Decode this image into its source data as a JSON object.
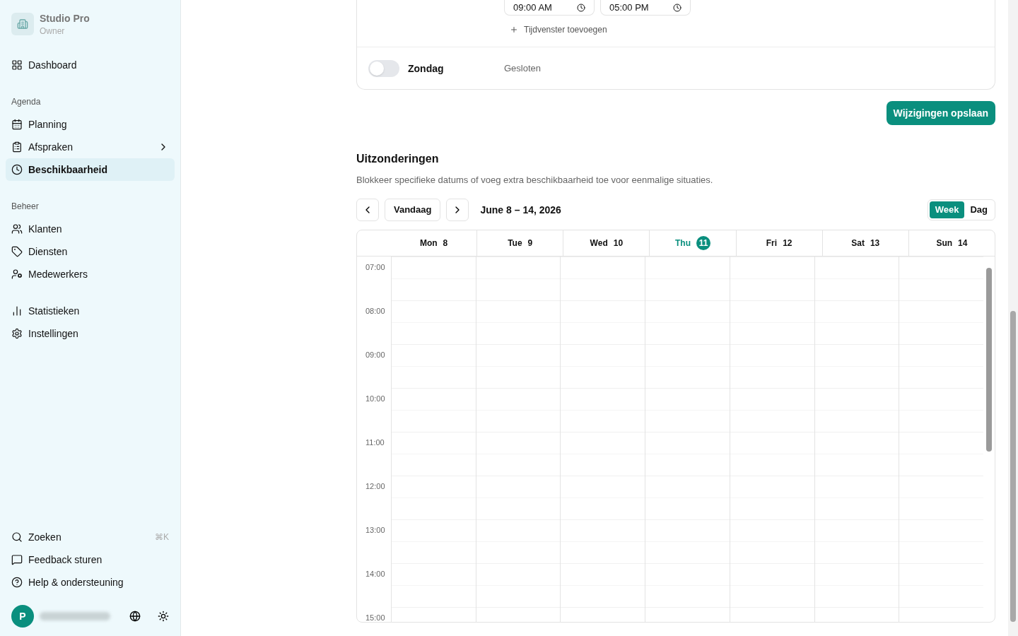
{
  "sidebar": {
    "brand": {
      "name": "Studio Pro",
      "role": "Owner"
    },
    "sections": [
      {
        "items": [
          {
            "label": "Dashboard",
            "selected": false
          }
        ]
      },
      {
        "heading": "Agenda",
        "items": [
          {
            "label": "Planning",
            "selected": false
          },
          {
            "label": "Afspraken",
            "selected": false,
            "has_submenu": true
          },
          {
            "label": "Beschikbaarheid",
            "selected": true
          }
        ]
      },
      {
        "heading": "Beheer",
        "items": [
          {
            "label": "Klanten",
            "selected": false
          },
          {
            "label": "Diensten",
            "selected": false
          },
          {
            "label": "Medewerkers",
            "selected": false
          }
        ]
      },
      {
        "items": [
          {
            "label": "Statistieken",
            "selected": false
          },
          {
            "label": "Instellingen",
            "selected": false
          }
        ]
      }
    ],
    "footer_items": [
      {
        "label": "Zoeken",
        "shortcut": "⌘K"
      },
      {
        "label": "Feedback sturen"
      },
      {
        "label": "Help & ondersteuning"
      }
    ],
    "user": {
      "initial": "P"
    }
  },
  "hours": {
    "time_from": "09:00 AM",
    "time_to": "05:00 PM",
    "add_window": "Tijdvenster toevoegen",
    "days": [
      {
        "label": "Zondag",
        "on": false,
        "status": "Gesloten"
      }
    ]
  },
  "save_button": "Wijzigingen opslaan",
  "exceptions": {
    "title": "Uitzonderingen",
    "description": "Blokkeer specifieke datums of voeg extra beschikbaarheid toe voor eenmalige situaties.",
    "today_button": "Vandaag",
    "range": "June 8 – 14, 2026",
    "views": [
      {
        "label": "Week",
        "selected": true
      },
      {
        "label": "Dag",
        "selected": false
      }
    ],
    "days": [
      {
        "name": "Mon",
        "date": "8",
        "selected": false
      },
      {
        "name": "Tue",
        "date": "9",
        "selected": false
      },
      {
        "name": "Wed",
        "date": "10",
        "selected": false
      },
      {
        "name": "Thu",
        "date": "11",
        "selected": true
      },
      {
        "name": "Fri",
        "date": "12",
        "selected": false
      },
      {
        "name": "Sat",
        "date": "13",
        "selected": false
      },
      {
        "name": "Sun",
        "date": "14",
        "selected": false
      }
    ],
    "hours": [
      "07:00",
      "08:00",
      "09:00",
      "10:00",
      "11:00",
      "12:00",
      "13:00",
      "14:00",
      "15:00"
    ]
  }
}
